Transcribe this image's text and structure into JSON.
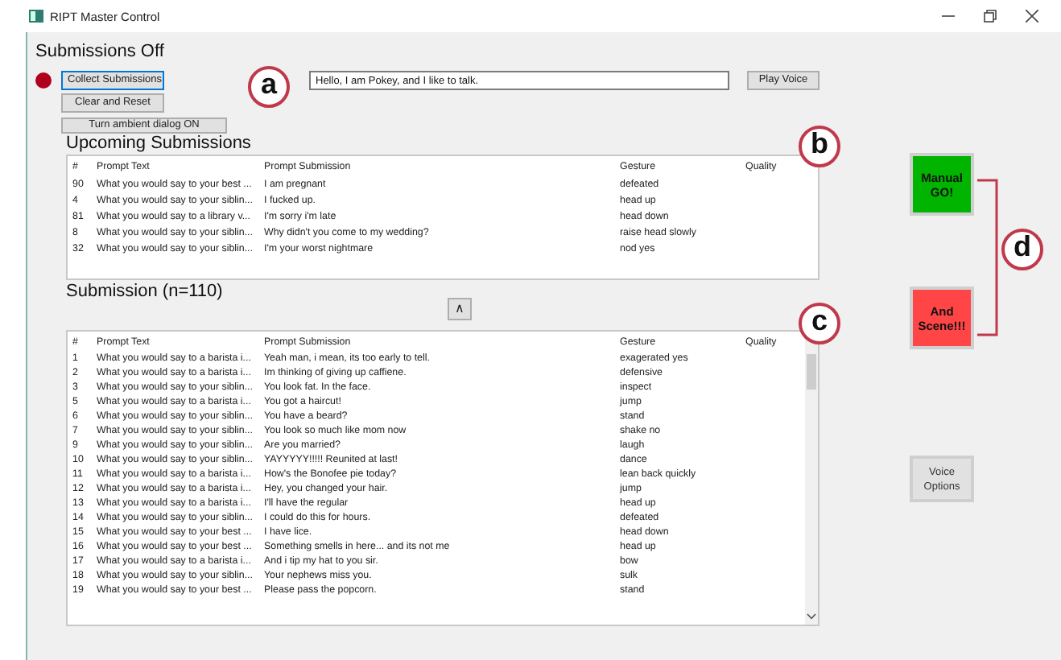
{
  "window": {
    "title": "RIPT Master Control"
  },
  "status_label": "Submissions Off",
  "left_buttons": [
    {
      "label": "Collect Submissions",
      "focused": true
    },
    {
      "label": "Clear and Reset",
      "focused": false
    }
  ],
  "speech_field": {
    "value": "Hello, I am Pokey, and I like to talk."
  },
  "play_button": "Play Voice",
  "ambient_button": "Turn ambient dialog ON",
  "upcoming": {
    "title": "Upcoming Submissions",
    "columns": [
      "#",
      "Prompt Text",
      "Prompt Submission",
      "Gesture",
      "Quality"
    ],
    "rows": [
      [
        "90",
        "What you would say to your best ...",
        "I am pregnant",
        "defeated"
      ],
      [
        "4",
        "What you would say to your siblin...",
        "I fucked up.",
        "head up"
      ],
      [
        "81",
        "What you would say to a library v...",
        "I'm sorry i'm late",
        "head down"
      ],
      [
        "8",
        "What you would say to your siblin...",
        "Why didn't you come to my wedding?",
        "raise head slowly"
      ],
      [
        "32",
        "What you would say to your siblin...",
        "I'm your worst nightmare",
        "nod yes"
      ]
    ]
  },
  "scroll_up_button": "∧",
  "submissions": {
    "title": "Submission (n=110)",
    "columns": [
      "#",
      "Prompt Text",
      "Prompt Submission",
      "Gesture",
      "Quality"
    ],
    "rows": [
      [
        "1",
        "What you would say to a barista i...",
        "Yeah man, i mean, its too early to tell.",
        "exagerated yes"
      ],
      [
        "2",
        "What you would say to a barista i...",
        "Im thinking of giving up caffiene.",
        "defensive"
      ],
      [
        "3",
        "What you would say to your siblin...",
        "You look fat. In the face.",
        "inspect"
      ],
      [
        "5",
        "What you would say to a barista i...",
        "You got a haircut!",
        "jump"
      ],
      [
        "6",
        "What you would say to your siblin...",
        "You have a beard?",
        "stand"
      ],
      [
        "7",
        "What you would say to your siblin...",
        "You look so much like mom now",
        "shake no"
      ],
      [
        "9",
        "What you would say to your siblin...",
        "Are you married?",
        "laugh"
      ],
      [
        "10",
        "What you would say to your siblin...",
        "YAYYYYY!!!!! Reunited at last!",
        "dance"
      ],
      [
        "11",
        "What you would say to a barista i...",
        "How's the Bonofee pie today?",
        "lean back quickly"
      ],
      [
        "12",
        "What you would say to a barista i...",
        "Hey, you changed your hair.",
        "jump"
      ],
      [
        "13",
        "What you would say to a barista i...",
        "I'll have the regular",
        "head up"
      ],
      [
        "14",
        "What you would say to your siblin...",
        "I could do this for hours.",
        "defeated"
      ],
      [
        "15",
        "What you would say to your best ...",
        "I have lice.",
        "head down"
      ],
      [
        "16",
        "What you would say to your best ...",
        "Something smells in here... and its not me",
        "head up"
      ],
      [
        "17",
        "What you would say to a barista i...",
        "And i tip my hat to you sir.",
        "bow"
      ],
      [
        "18",
        "What you would say to your siblin...",
        "Your nephews miss you.",
        "sulk"
      ],
      [
        "19",
        "What you would say to your best ...",
        "Please pass the popcorn.",
        "stand"
      ]
    ]
  },
  "side_buttons": [
    {
      "label": "Manual GO!",
      "kind": "go"
    },
    {
      "label": "And Scene!!!",
      "kind": "stop"
    },
    {
      "label": "Voice Options",
      "kind": "plain"
    }
  ],
  "callouts": [
    "a",
    "b",
    "c",
    "d"
  ]
}
